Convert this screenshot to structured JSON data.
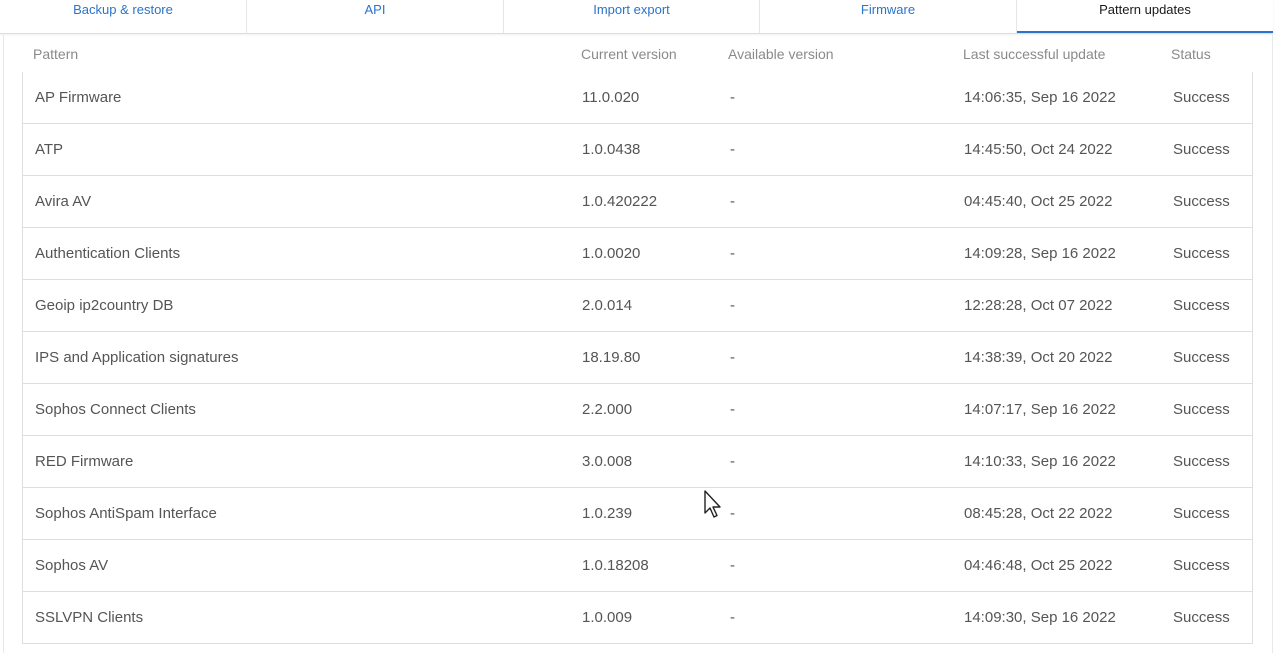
{
  "tabs": [
    {
      "label": "Backup & restore",
      "active": false
    },
    {
      "label": "API",
      "active": false
    },
    {
      "label": "Import export",
      "active": false
    },
    {
      "label": "Firmware",
      "active": false
    },
    {
      "label": "Pattern updates",
      "active": true
    }
  ],
  "table": {
    "headers": {
      "pattern": "Pattern",
      "current": "Current version",
      "available": "Available version",
      "last": "Last successful update",
      "status": "Status"
    },
    "rows": [
      {
        "pattern": "AP Firmware",
        "current": "11.0.020",
        "available": "-",
        "last": "14:06:35, Sep 16 2022",
        "status": "Success"
      },
      {
        "pattern": "ATP",
        "current": "1.0.0438",
        "available": "-",
        "last": "14:45:50, Oct 24 2022",
        "status": "Success"
      },
      {
        "pattern": "Avira AV",
        "current": "1.0.420222",
        "available": "-",
        "last": "04:45:40, Oct 25 2022",
        "status": "Success"
      },
      {
        "pattern": "Authentication Clients",
        "current": "1.0.0020",
        "available": "-",
        "last": "14:09:28, Sep 16 2022",
        "status": "Success"
      },
      {
        "pattern": "Geoip ip2country DB",
        "current": "2.0.014",
        "available": "-",
        "last": "12:28:28, Oct 07 2022",
        "status": "Success"
      },
      {
        "pattern": "IPS and Application signatures",
        "current": "18.19.80",
        "available": "-",
        "last": "14:38:39, Oct 20 2022",
        "status": "Success"
      },
      {
        "pattern": "Sophos Connect Clients",
        "current": "2.2.000",
        "available": "-",
        "last": "14:07:17, Sep 16 2022",
        "status": "Success"
      },
      {
        "pattern": "RED Firmware",
        "current": "3.0.008",
        "available": "-",
        "last": "14:10:33, Sep 16 2022",
        "status": "Success"
      },
      {
        "pattern": "Sophos AntiSpam Interface",
        "current": "1.0.239",
        "available": "-",
        "last": "08:45:28, Oct 22 2022",
        "status": "Success"
      },
      {
        "pattern": "Sophos AV",
        "current": "1.0.18208",
        "available": "-",
        "last": "04:46:48, Oct 25 2022",
        "status": "Success"
      },
      {
        "pattern": "SSLVPN Clients",
        "current": "1.0.009",
        "available": "-",
        "last": "14:09:30, Sep 16 2022",
        "status": "Success"
      }
    ]
  },
  "colors": {
    "accent": "#2a74c9",
    "border": "#dedede",
    "header_text": "#8a8a8a",
    "cell_text": "#555555"
  },
  "icons": {
    "cursor": "mouse-pointer-icon"
  }
}
